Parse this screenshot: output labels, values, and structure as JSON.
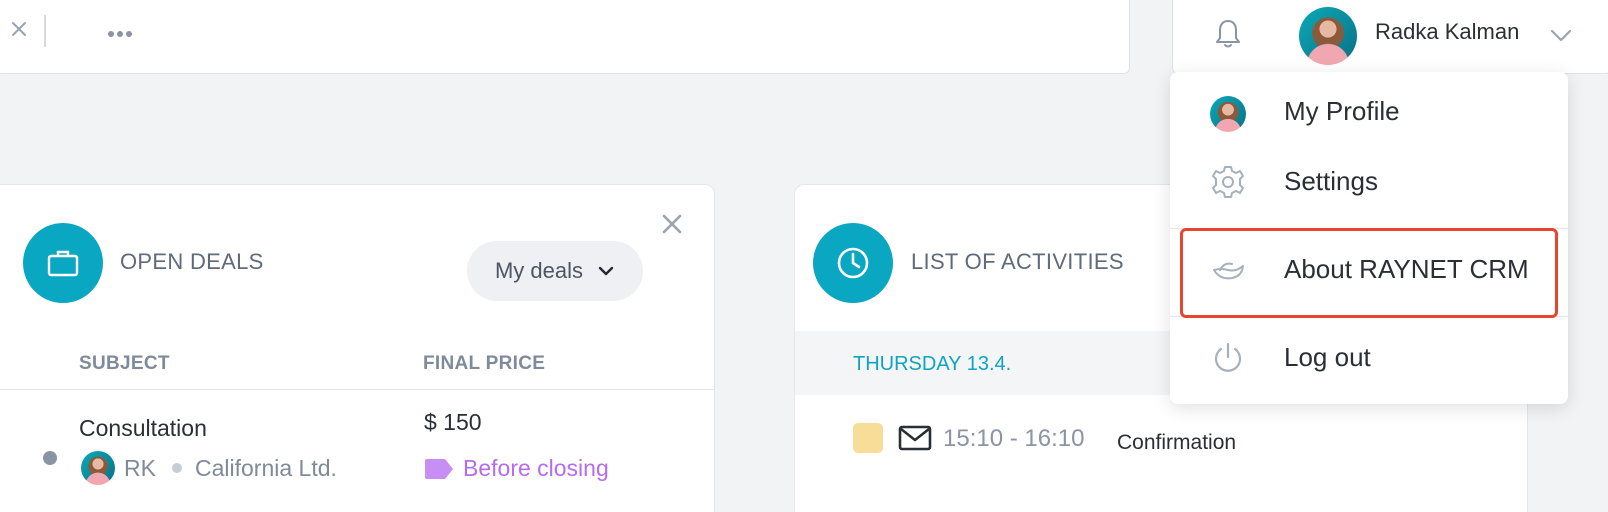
{
  "topbar": {
    "user_name": "Radka Kalman"
  },
  "user_menu": {
    "items": [
      {
        "label": "My Profile",
        "icon": "avatar"
      },
      {
        "label": "Settings",
        "icon": "gear-icon"
      },
      {
        "label": "About RAYNET CRM",
        "icon": "raynet-logo-icon"
      },
      {
        "label": "Log out",
        "icon": "power-icon"
      }
    ],
    "highlight_color": "#e8452c"
  },
  "open_deals": {
    "title": "OPEN DEALS",
    "filter_label": "My deals",
    "columns": [
      "SUBJECT",
      "FINAL PRICE"
    ],
    "rows": [
      {
        "subject": "Consultation",
        "owner": "RK",
        "company": "California Ltd.",
        "price": "$ 150",
        "stage": "Before closing"
      }
    ]
  },
  "activities": {
    "title": "LIST OF ACTIVITIES",
    "date": "THURSDAY 13.4.",
    "items": [
      {
        "time": "15:10 - 16:10",
        "title": "Confirmation"
      }
    ]
  },
  "colors": {
    "accent": "#0aa7c3",
    "stage": "#b46cf0",
    "date": "#12a3c2"
  }
}
